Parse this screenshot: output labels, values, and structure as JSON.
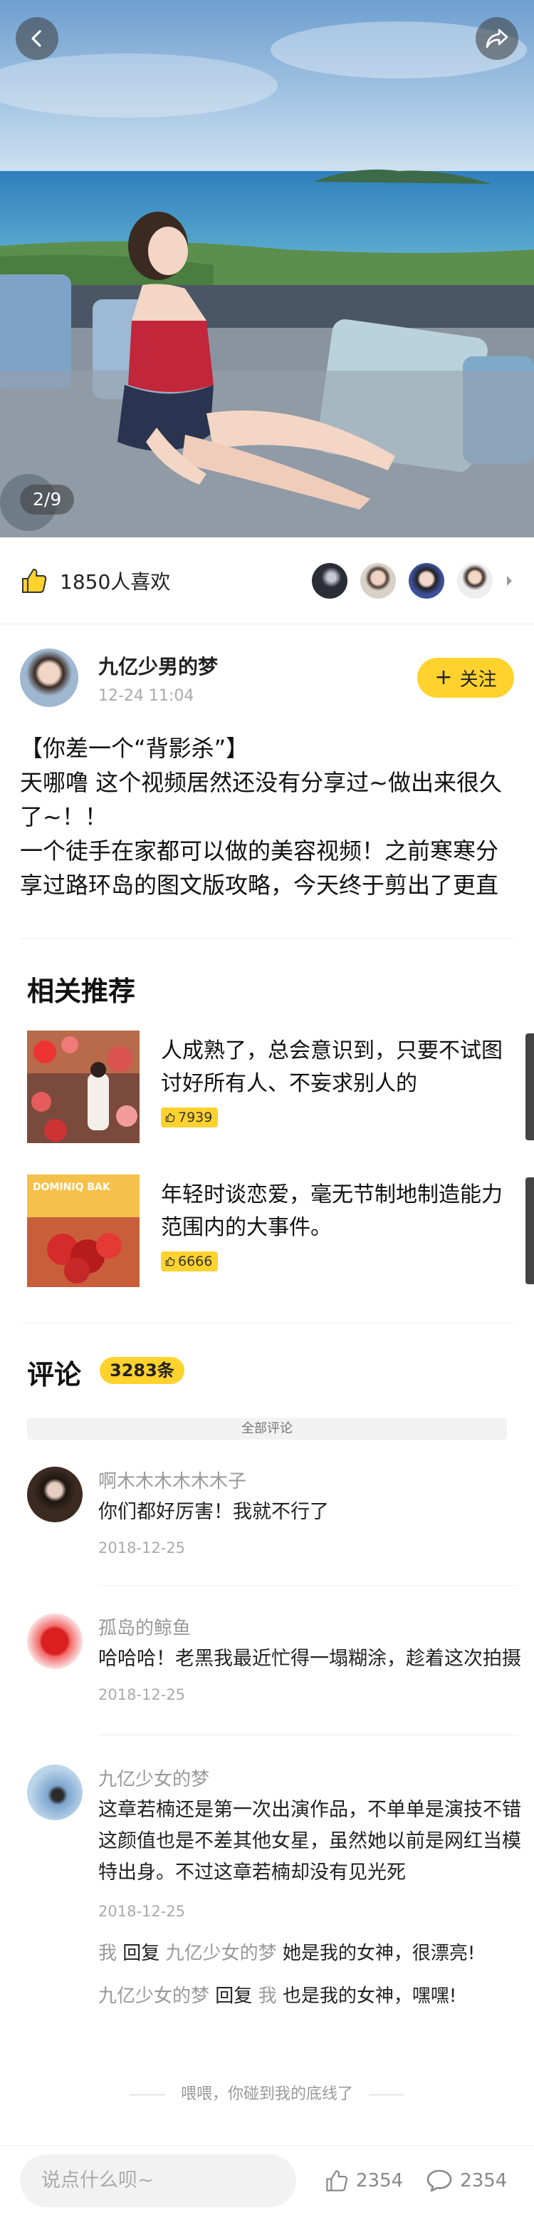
{
  "hero": {
    "counter": "2/9"
  },
  "likes": {
    "text": "1850人喜欢"
  },
  "author": {
    "name": "九亿少男的梦",
    "time": "12-24 11:04",
    "follow_label": "关注",
    "follow_plus": "+"
  },
  "post": {
    "lines": [
      "【你差一个“背影杀”】",
      "天哪噜 这个视频居然还没有分享过~做出来很久了~！！",
      "一个徒手在家都可以做的美容视频！之前寒寒分享过路环岛的图文版攻略，今天终于剪出了更直"
    ]
  },
  "related": {
    "title": "相关推荐",
    "items": [
      {
        "title": "人成熟了，总会意识到，只要不试图讨好所有人、不妄求别人的",
        "likes": "7939"
      },
      {
        "title": "年轻时谈恋爱，毫无节制地制造能力范围内的大事件。",
        "likes": "6666",
        "sign": "DOMINIQ BAK"
      }
    ]
  },
  "comments": {
    "title": "评论",
    "count": "3283条",
    "all_label": "全部评论",
    "items": [
      {
        "name": "啊木木木木木木子",
        "body": "你们都好厉害！我就不行了",
        "date": "2018-12-25"
      },
      {
        "name": "孤岛的鲸鱼",
        "body": "哈哈哈！老黑我最近忙得一塌糊涂，趁着这次拍摄",
        "date": "2018-12-25"
      },
      {
        "name": "九亿少女的梦",
        "body": "这章若楠还是第一次出演作品，不单单是演技不错这颜值也是不差其他女星，虽然她以前是网红当模特出身。不过这章若楠却没有见光死",
        "date": "2018-12-25"
      }
    ],
    "replies": [
      {
        "from": "我",
        "verb": "回复",
        "to": "九亿少女的梦",
        "text": "她是我的女神，很漂亮!"
      },
      {
        "from": "九亿少女的梦",
        "verb": "回复",
        "to": "我",
        "text": "也是我的女神，嘿嘿!"
      }
    ],
    "end_text": "喂喂，你碰到我的底线了"
  },
  "bottom_bar": {
    "placeholder": "说点什么呗~",
    "like_count": "2354",
    "comment_count": "2354"
  },
  "colors": {
    "accent": "#ffd22e"
  },
  "icons": [
    "back-icon",
    "share-icon",
    "thumbs-up-icon",
    "chevron-right-icon",
    "comment-icon"
  ]
}
